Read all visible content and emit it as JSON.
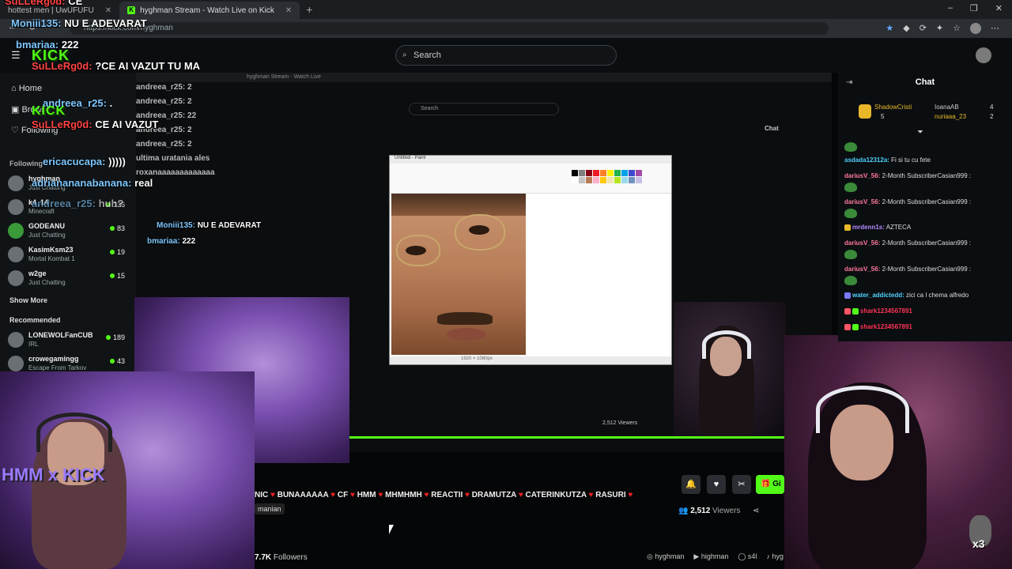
{
  "browser": {
    "tabs": [
      {
        "title": "hottest men | UwUFUFU",
        "active": false
      },
      {
        "title": "hyghman Stream - Watch Live on Kick",
        "active": true
      }
    ],
    "url": "https://kick.com/hyghman",
    "window_controls": [
      "–",
      "❐",
      "✕"
    ]
  },
  "kick_header": {
    "search_placeholder": "Search"
  },
  "sidebar": {
    "nav": [
      {
        "label": "Home",
        "icon": "home-icon"
      },
      {
        "label": "Browse",
        "icon": "browse-icon"
      },
      {
        "label": "Following",
        "icon": "heart-icon"
      }
    ],
    "following_title": "Following",
    "channels": [
      {
        "name": "hyghman",
        "category": "Just Chatting",
        "viewers": ""
      },
      {
        "name": "k4_14",
        "category": "Minecraft",
        "viewers": "136"
      },
      {
        "name": "GODEANU",
        "category": "Just Chatting",
        "viewers": "83"
      },
      {
        "name": "KasimKsm23",
        "category": "Mortal Kombat 1",
        "viewers": "19"
      },
      {
        "name": "w2ge",
        "category": "Just Chatting",
        "viewers": "15"
      }
    ],
    "show_more": "Show More",
    "recommended_title": "Recommended",
    "recommended": [
      {
        "name": "LONEWOLFanCUB",
        "category": "IRL",
        "viewers": "189"
      },
      {
        "name": "crowegamingg",
        "category": "Escape From Tarkov",
        "viewers": "43"
      }
    ]
  },
  "overlay_chat": [
    {
      "user": "SuLLeRg0d:",
      "text": "CE",
      "color": "red"
    },
    {
      "user": "Moniii135:",
      "text": "NU E ADEVARAT",
      "color": "blue"
    },
    {
      "user": "bmariaa:",
      "text": "222",
      "color": "blue"
    },
    {
      "user": "SuLLeRg0d:",
      "text": "?CE AI VAZUT TU MA",
      "color": "red"
    },
    {
      "user": "andreea_r25:",
      "text": ".",
      "color": "blue"
    },
    {
      "user": "SuLLeRg0d:",
      "text": "CE AI VAZUT",
      "color": "red"
    },
    {
      "user": "ericacucapa:",
      "text": ")))))",
      "color": "blue"
    },
    {
      "user": "adrianananabanana:",
      "text": "real",
      "color": "blue"
    },
    {
      "user": "andreea_r25:",
      "text": "huh?",
      "color": "blue"
    },
    {
      "user": "Moniii135:",
      "text": "NU E ADEVARAT",
      "color": "blue"
    },
    {
      "user": "bmariaa:",
      "text": "222",
      "color": "blue"
    }
  ],
  "kick_logo_text": "KICK",
  "nested": {
    "search": "Search",
    "chat_title": "Chat",
    "overlay_lines": [
      "andreea_r25: 2",
      "andreea_r25: 2",
      "andreea_r25: 22",
      "andreea_r25: 2",
      "andreea_r25: 2",
      "ultima uratania ales",
      "roxanaaaaaaaaaaaaa"
    ]
  },
  "paint": {
    "title": "Untitled - Paint",
    "status": "1920 × 1080px"
  },
  "stream": {
    "title_segments": [
      "NIC",
      "BUNAAAAAA",
      "CF",
      "HMM",
      "MHMHMH",
      "REACTII",
      "DRAMUTZA",
      "CATERINKUTZA",
      "RASURI"
    ],
    "tag": "manian",
    "viewers": "2,512",
    "viewers_label": "Viewers",
    "followers": "7.7K",
    "followers_label": "Followers",
    "small_viewers": "2,512 Viewers",
    "socials": [
      "hyghman",
      "highman",
      "s4l",
      "hyg"
    ],
    "gift_label": "Gi"
  },
  "chat": {
    "title": "Chat",
    "pinned": [
      {
        "name": "ShadowCristi",
        "count": "5"
      },
      {
        "name": "IoanaAB",
        "count": "4"
      },
      {
        "name": "nuriaaa_23",
        "count": "2"
      }
    ],
    "messages": [
      {
        "user": "asdada12312a:",
        "text": "Fi si tu cu fete",
        "color": "#4fd1ff"
      },
      {
        "user": "dariusV_56:",
        "text": "2-Month SubscriberCasian999 :",
        "color": "#ff7aa0"
      },
      {
        "user": "dariusV_56:",
        "text": "2-Month SubscriberCasian999 :",
        "color": "#ff7aa0"
      },
      {
        "user": "mrdenn1s:",
        "text": "AZTECA",
        "color": "#b58aff"
      },
      {
        "user": "dariusV_56:",
        "text": "2-Month SubscriberCasian999 :",
        "color": "#ff7aa0"
      },
      {
        "user": "dariusV_56:",
        "text": "2-Month SubscriberCasian999 :",
        "color": "#ff7aa0"
      },
      {
        "user": "water_addictedd:",
        "text": "zici ca l chema alfredo",
        "color": "#4fd1ff"
      },
      {
        "user": "shark1234567891",
        "text": "",
        "color": "#ff3355"
      },
      {
        "user": "shark1234567891",
        "text": "",
        "color": "#ff3355"
      }
    ]
  },
  "watermark": "HMM x KICK",
  "badge_x3": "x3",
  "colors": {
    "kick_green": "#53fc18",
    "background": "#0b0e10"
  }
}
